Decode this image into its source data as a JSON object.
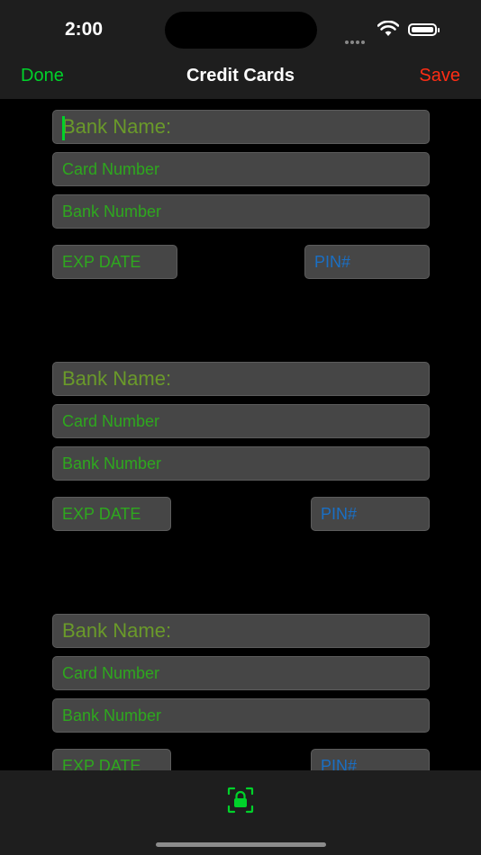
{
  "status": {
    "time": "2:00"
  },
  "nav": {
    "done": "Done",
    "title": "Credit Cards",
    "save": "Save"
  },
  "cards": [
    {
      "bank_name": "Bank Name:",
      "card_number": "Card Number",
      "bank_number": "Bank Number",
      "exp_date": "EXP DATE",
      "pin": "PIN#"
    },
    {
      "bank_name": "Bank Name:",
      "card_number": "Card Number",
      "bank_number": "Bank Number",
      "exp_date": "EXP DATE",
      "pin": "PIN#"
    },
    {
      "bank_name": "Bank Name:",
      "card_number": "Card Number",
      "bank_number": "Bank Number",
      "exp_date": "EXP DATE",
      "pin": "PIN#"
    }
  ],
  "tabbar": {
    "icon": "lock-icon"
  },
  "colors": {
    "accent_green": "#00d22a",
    "save_red": "#ff2d14",
    "field_text_green": "#2ea81e",
    "pin_blue": "#1a6fc4"
  }
}
